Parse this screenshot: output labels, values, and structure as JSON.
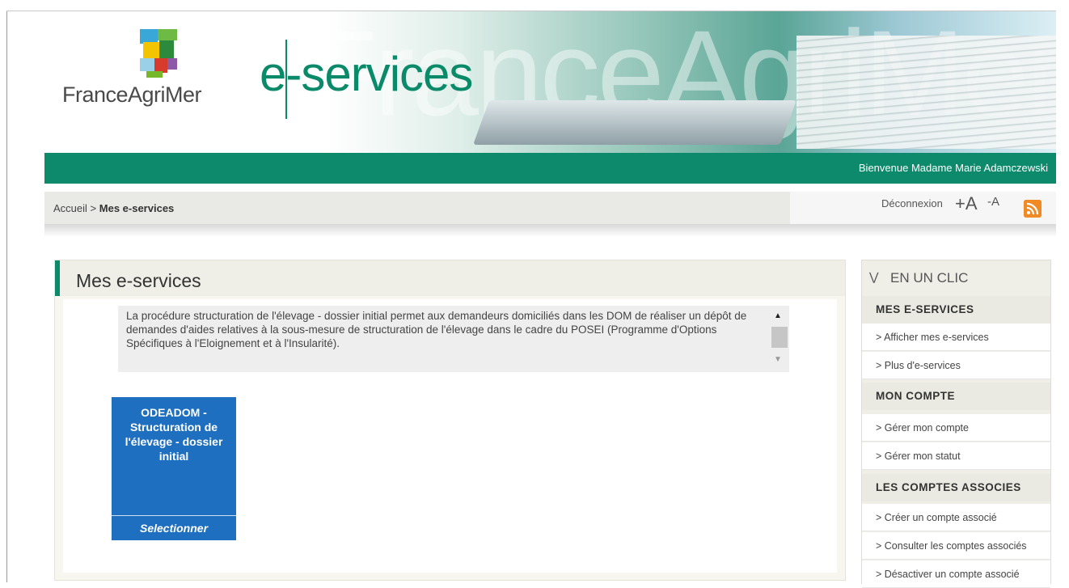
{
  "header": {
    "logo_text": "FranceAgriMer",
    "app_title": "e-services",
    "watermark": "FranceAgriMer",
    "welcome": "Bienvenue Madame Marie Adamczewski"
  },
  "breadcrumb": {
    "home": "Accueil",
    "separator": ">",
    "current": "Mes e-services"
  },
  "toolbar": {
    "logout": "Déconnexion",
    "font_increase": "+A",
    "font_decrease": "-A",
    "rss_icon": "rss-icon"
  },
  "main": {
    "title": "Mes e-services",
    "description": "La procédure structuration de l'élevage - dossier initial permet aux demandeurs domiciliés dans les DOM de réaliser un dépôt de demandes d'aides relatives à la sous-mesure de structuration de l'élevage dans le cadre du POSEI (Programme d'Options Spécifiques à l'Eloignement et à l'Insularité).",
    "tile": {
      "title": "ODEADOM - Structuration de l'élevage - dossier initial",
      "action": "Selectionner"
    }
  },
  "sidebar": {
    "title": "EN UN CLIC",
    "sections": [
      {
        "heading": "MES E-SERVICES",
        "links": [
          "> Afficher mes e-services",
          "> Plus d'e-services"
        ]
      },
      {
        "heading": "MON COMPTE",
        "links": [
          "> Gérer mon compte",
          "> Gérer mon statut"
        ]
      },
      {
        "heading": "LES COMPTES ASSOCIES",
        "links": [
          "> Créer un compte associé",
          "> Consulter les comptes associés",
          "> Désactiver un compte associé"
        ]
      }
    ]
  },
  "colors": {
    "brand_green": "#0d8a6c",
    "tile_blue": "#1e6fbf",
    "rss_orange": "#f08a24"
  }
}
